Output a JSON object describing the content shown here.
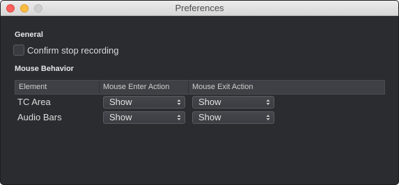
{
  "window": {
    "title": "Preferences"
  },
  "general": {
    "heading": "General",
    "confirm_stop_recording": {
      "label": "Confirm stop recording",
      "checked": false
    }
  },
  "mouse_behavior": {
    "heading": "Mouse Behavior",
    "columns": [
      "Element",
      "Mouse Enter Action",
      "Mouse Exit Action"
    ],
    "rows": [
      {
        "element": "TC Area",
        "enter_action": "Show",
        "exit_action": "Show"
      },
      {
        "element": "Audio Bars",
        "enter_action": "Show",
        "exit_action": "Show"
      }
    ]
  },
  "colors": {
    "window_background": "#2b2c30",
    "titlebar": "#e3e3e3",
    "close_button": "#fc605c",
    "minimize_button": "#fdbc40",
    "zoom_button_inactive": "#cfcfcf"
  }
}
